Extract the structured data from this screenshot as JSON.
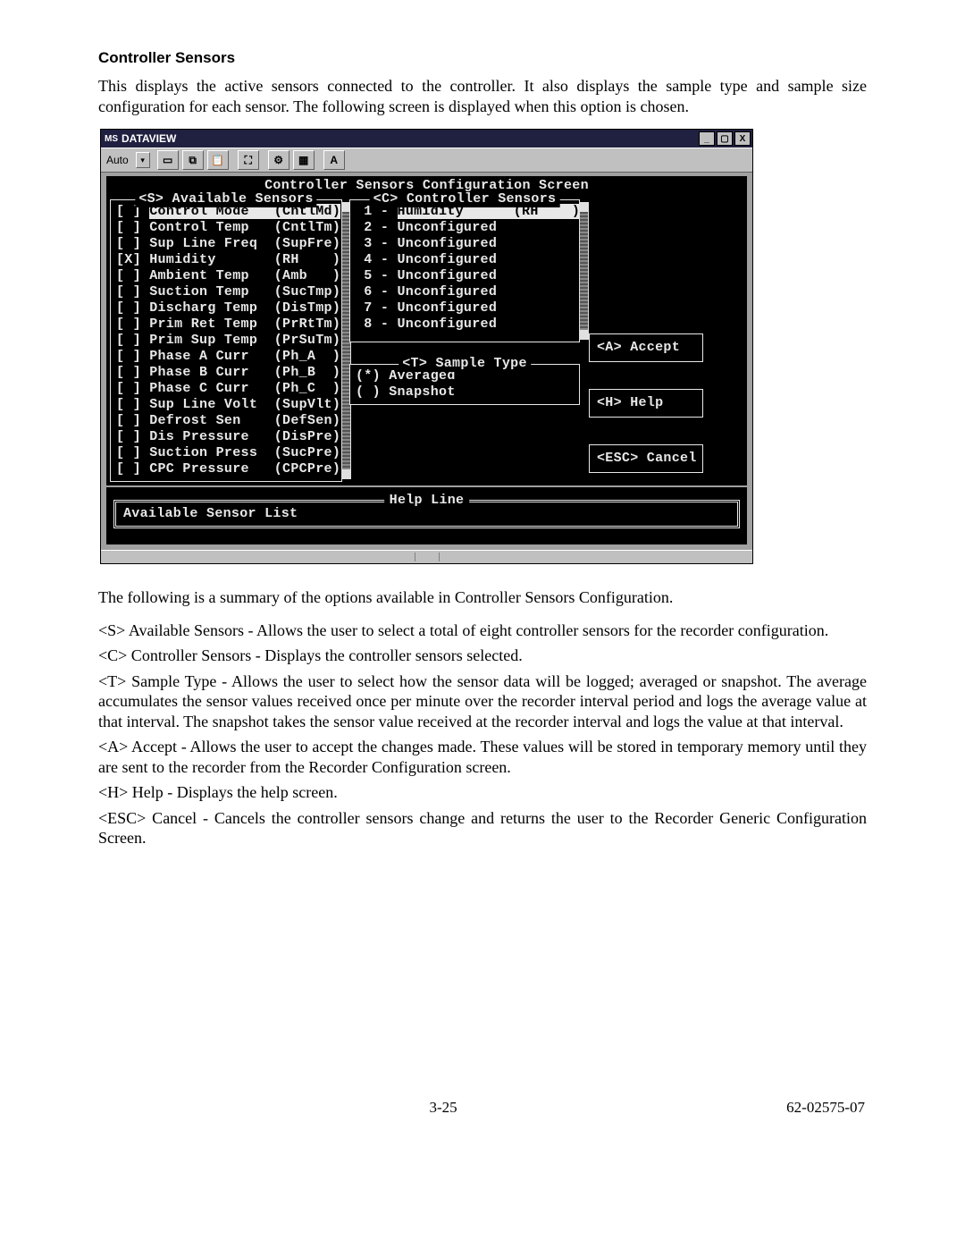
{
  "heading": "Controller Sensors",
  "intro": "This displays the active sensors connected to the controller. It also displays the sample type and sample size configuration for each sensor. The following screen is displayed when this option is chosen.",
  "window": {
    "title": "DATAVIEW",
    "sys_minimize": "_",
    "sys_maximize": "▢",
    "sys_close": "X",
    "toolbar": {
      "auto": "Auto",
      "dropdown_arrow": "▾",
      "btn_a": "A"
    }
  },
  "terminal": {
    "title": "Controller Sensors Configuration Screen",
    "available_legend": "<S> Available Sensors",
    "controller_legend": "<C> Controller Sensors",
    "sample_legend": "<T> Sample Type",
    "help_legend": "Help Line",
    "help_text": "Available Sensor List",
    "available": [
      {
        "mark": "[ ]",
        "name": "Control Mode",
        "code": "(CntlMd)",
        "hl": true
      },
      {
        "mark": "[ ]",
        "name": "Control Temp",
        "code": "(CntlTm)",
        "hl": false
      },
      {
        "mark": "[ ]",
        "name": "Sup Line Freq",
        "code": "(SupFre)",
        "hl": false
      },
      {
        "mark": "[X]",
        "name": "Humidity",
        "code": "(RH    )",
        "hl": false
      },
      {
        "mark": "[ ]",
        "name": "Ambient Temp",
        "code": "(Amb   )",
        "hl": false
      },
      {
        "mark": "[ ]",
        "name": "Suction Temp",
        "code": "(SucTmp)",
        "hl": false
      },
      {
        "mark": "[ ]",
        "name": "Discharg Temp",
        "code": "(DisTmp)",
        "hl": false
      },
      {
        "mark": "[ ]",
        "name": "Prim Ret Temp",
        "code": "(PrRtTm)",
        "hl": false
      },
      {
        "mark": "[ ]",
        "name": "Prim Sup Temp",
        "code": "(PrSuTm)",
        "hl": false
      },
      {
        "mark": "[ ]",
        "name": "Phase A Curr",
        "code": "(Ph_A  )",
        "hl": false
      },
      {
        "mark": "[ ]",
        "name": "Phase B Curr",
        "code": "(Ph_B  )",
        "hl": false
      },
      {
        "mark": "[ ]",
        "name": "Phase C Curr",
        "code": "(Ph_C  )",
        "hl": false
      },
      {
        "mark": "[ ]",
        "name": "Sup Line Volt",
        "code": "(SupVlt)",
        "hl": false
      },
      {
        "mark": "[ ]",
        "name": "Defrost Sen",
        "code": "(DefSen)",
        "hl": false
      },
      {
        "mark": "[ ]",
        "name": "Dis Pressure",
        "code": "(DisPre)",
        "hl": false
      },
      {
        "mark": "[ ]",
        "name": "Suction Press",
        "code": "(SucPre)",
        "hl": false
      },
      {
        "mark": "[ ]",
        "name": "CPC Pressure",
        "code": "(CPCPre)",
        "hl": false
      }
    ],
    "controller": [
      {
        "n": "1",
        "txt": "Humidity      (RH    )",
        "hl": true
      },
      {
        "n": "2",
        "txt": "Unconfigured",
        "hl": false
      },
      {
        "n": "3",
        "txt": "Unconfigured",
        "hl": false
      },
      {
        "n": "4",
        "txt": "Unconfigured",
        "hl": false
      },
      {
        "n": "5",
        "txt": "Unconfigured",
        "hl": false
      },
      {
        "n": "6",
        "txt": "Unconfigured",
        "hl": false
      },
      {
        "n": "7",
        "txt": "Unconfigured",
        "hl": false
      },
      {
        "n": "8",
        "txt": "Unconfigured",
        "hl": false
      }
    ],
    "sample": [
      {
        "mark": "(*)",
        "label": "Averaged"
      },
      {
        "mark": "( )",
        "label": "Snapshot"
      }
    ],
    "actions": {
      "accept": "<A> Accept",
      "help": "<H> Help",
      "cancel": "<ESC> Cancel"
    }
  },
  "summary_intro": "The following is a summary of the options available in Controller Sensors Configuration.",
  "summary": [
    "<S> Available Sensors - Allows the user to select a total of eight controller sensors for the recorder configuration.",
    "<C> Controller Sensors - Displays the controller sensors selected.",
    "<T> Sample Type - Allows the user to select how the sensor data will be logged; averaged or snapshot. The average accumulates the sensor values received once per minute over the recorder interval period and logs the average value at that interval. The snapshot takes the sensor value received at the recorder interval and logs the value at that interval.",
    "<A> Accept - Allows the user to accept the changes made. These values will be stored in temporary memory until they are sent to the recorder from the Recorder Configuration screen.",
    "<H> Help - Displays the help screen.",
    "<ESC> Cancel - Cancels the controller sensors change and returns the user to the Recorder Generic Configuration Screen."
  ],
  "footer": {
    "page": "3-25",
    "doc": "62-02575-07"
  }
}
